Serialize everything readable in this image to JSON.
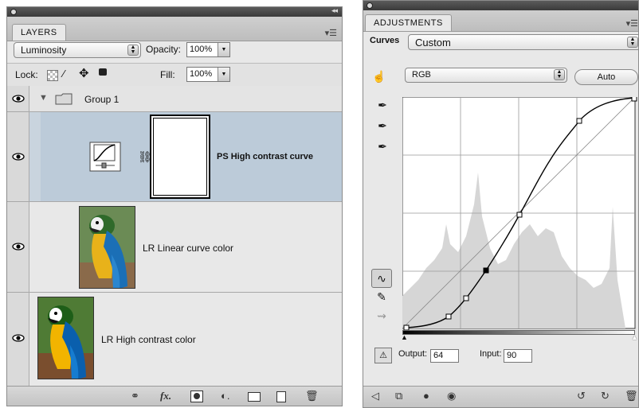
{
  "layers_panel": {
    "tab_label": "LAYERS",
    "blend_mode": "Luminosity",
    "opacity_label": "Opacity:",
    "opacity_value": "100%",
    "lock_label": "Lock:",
    "fill_label": "Fill:",
    "fill_value": "100%",
    "group_name": "Group 1",
    "layers": [
      {
        "name": "PS High contrast curve",
        "type": "adjustment",
        "selected": true
      },
      {
        "name": "LR Linear curve color",
        "type": "image",
        "selected": false
      },
      {
        "name": "LR High contrast color",
        "type": "image",
        "selected": false
      }
    ]
  },
  "adjustments_panel": {
    "tab_label": "ADJUSTMENTS",
    "curves_label": "Curves",
    "preset_value": "Custom",
    "channel_value": "RGB",
    "auto_label": "Auto",
    "output_label": "Output:",
    "output_value": "64",
    "input_label": "Input:",
    "input_value": "90",
    "curve_points": [
      [
        0,
        0
      ],
      [
        25,
        7
      ],
      [
        38,
        18
      ],
      [
        51,
        32
      ],
      [
        64,
        49
      ],
      [
        94,
        80
      ],
      [
        118,
        100
      ]
    ],
    "selected_point": [
      51,
      32
    ]
  },
  "colors": {
    "selected_row": "#bccbd9",
    "panel_bg": "#e8e8e8",
    "histogram": "#d6d6d6"
  }
}
